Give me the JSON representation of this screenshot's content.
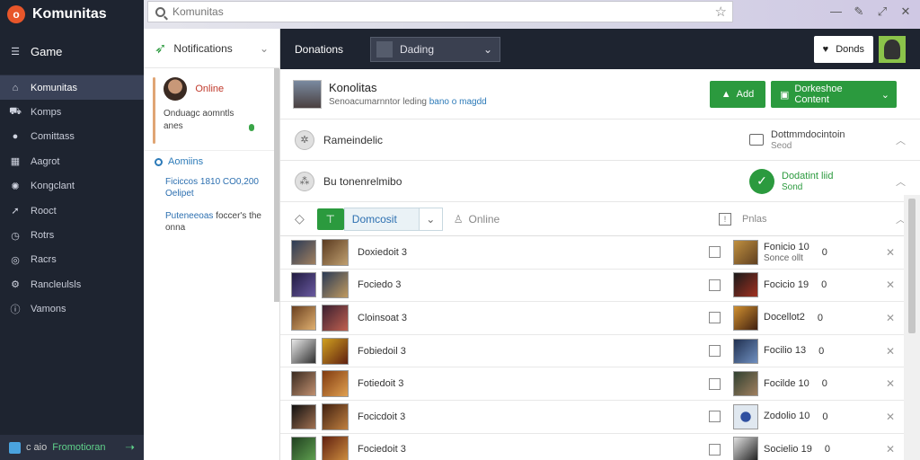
{
  "brand": {
    "name": "Komunitas",
    "logo_letter": "o"
  },
  "search": {
    "value": "",
    "placeholder": "Komunitas"
  },
  "top_icons": [
    "minimize-icon",
    "pin-icon",
    "maximize-icon",
    "close-icon"
  ],
  "sidebar": {
    "game_label": "Game",
    "items": [
      {
        "label": "Komunitas",
        "icon": "home-icon",
        "active": true
      },
      {
        "label": "Komps",
        "icon": "car-icon"
      },
      {
        "label": "Comittass",
        "icon": "circle-icon"
      },
      {
        "label": "Aagrot",
        "icon": "grid-icon"
      },
      {
        "label": "Kongclant",
        "icon": "settings-icon"
      },
      {
        "label": "Rooct",
        "icon": "pin-icon"
      },
      {
        "label": "Rotrs",
        "icon": "clock-icon"
      },
      {
        "label": "Racrs",
        "icon": "target-icon"
      },
      {
        "label": "Rancleulsls",
        "icon": "wrench-icon"
      },
      {
        "label": "Vamons",
        "icon": "info-icon"
      }
    ],
    "footer": {
      "prefix": "c aio",
      "label": "Fromotioran"
    }
  },
  "notifications": {
    "title": "Notifications",
    "card": {
      "status": "Online",
      "text": "Onduagc aomntls anes"
    },
    "section": {
      "title": "Aomiins",
      "entries": [
        {
          "a": "Ficiccos 1810 CO0,200 Oelipet",
          "b": ""
        },
        {
          "a": "Puteneeoas",
          "b": "foccer's the onna"
        }
      ]
    }
  },
  "toolbar": {
    "label": "Donations",
    "select_value": "Dading",
    "donate_label": "Donds"
  },
  "header": {
    "name": "Konolitas",
    "sub_prefix": "Senoacumarnntor leding",
    "sub_link": "bano o magdd",
    "add_label": "Add",
    "download_label": "Dorkeshoe Content"
  },
  "sections": [
    {
      "title": "Rameindelic",
      "right_title": "Dottmmdocintoin",
      "right_sub": "Seod",
      "status": "comment"
    },
    {
      "title": "Bu tonenrelmibo",
      "right_title": "Dodatint liid",
      "right_sub": "Sond",
      "status": "done"
    }
  ],
  "filter": {
    "select_value": "Domcosit",
    "online_label": "Online",
    "right_label": "Pnlas"
  },
  "rows": [
    {
      "name": "Doxiedoit 3",
      "right_title": "Fonicio 10",
      "right_sub": "Sonce ollt",
      "count": "0"
    },
    {
      "name": "Fociedo 3",
      "right_title": "Focicio 19",
      "right_sub": "",
      "count": "0"
    },
    {
      "name": "Cloinsoat 3",
      "right_title": "Docellot2",
      "right_sub": "",
      "count": "0"
    },
    {
      "name": "Fobiedoil 3",
      "right_title": "Focilio 13",
      "right_sub": "",
      "count": "0"
    },
    {
      "name": "Fotiedoit 3",
      "right_title": "Focilde 10",
      "right_sub": "",
      "count": "0"
    },
    {
      "name": "Focicdoit 3",
      "right_title": "Zodolio 10",
      "right_sub": "",
      "count": "0"
    },
    {
      "name": "Fociedoit 3",
      "right_title": "Socielio 19",
      "right_sub": "",
      "count": "0"
    }
  ],
  "colors": {
    "accent_green": "#2b9a3e",
    "sidebar_dark": "#1e2430",
    "brand_orange": "#e8562a",
    "link_blue": "#2c7ab8"
  }
}
